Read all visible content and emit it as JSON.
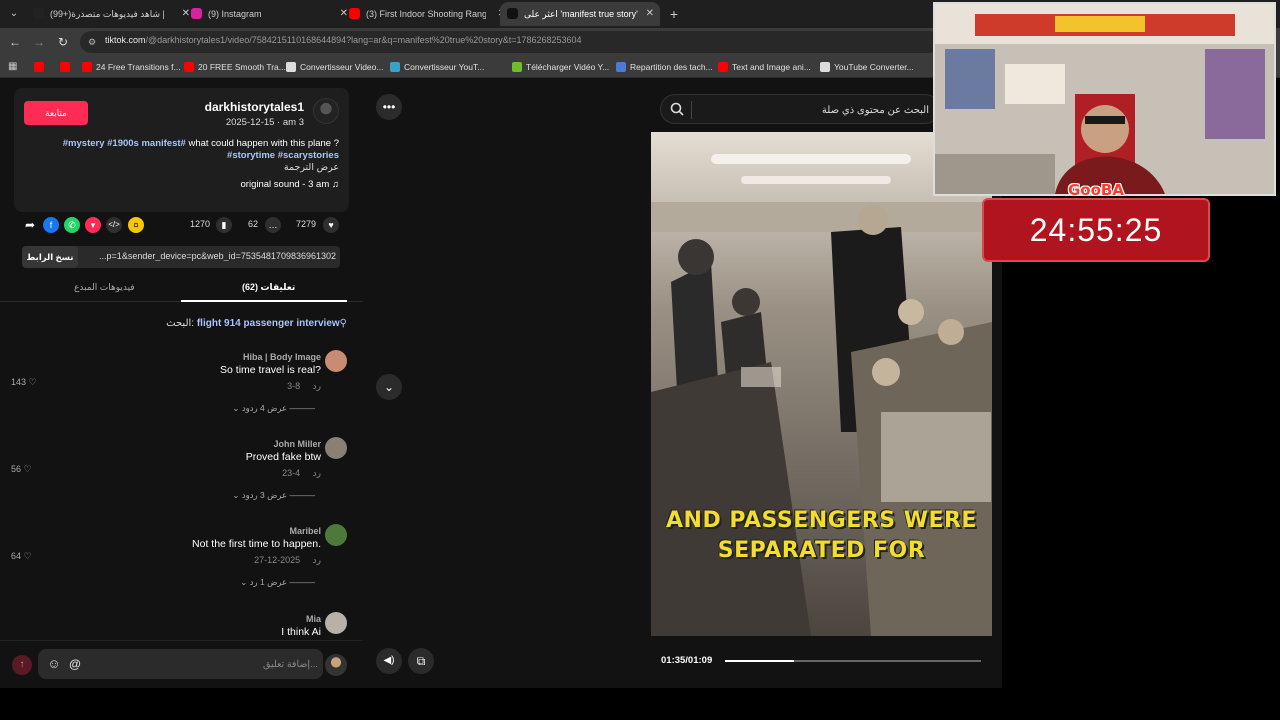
{
  "browser": {
    "tabs": [
      {
        "title": "(99+)شاهد فيديوهات متصدرة |",
        "favicon_color": "#222222",
        "active": false
      },
      {
        "title": "(9) Instagram",
        "favicon_color": "#d6249f",
        "active": false
      },
      {
        "title": "(3) First Indoor Shooting Range",
        "favicon_color": "#ff0000",
        "active": false
      },
      {
        "title": "اعثر على 'manifest true story'",
        "favicon_color": "#111111",
        "active": true
      }
    ],
    "close_glyph": "✕",
    "new_tab_glyph": "+",
    "url_host": "tiktok.com",
    "url_path": "/@darkhistorytales1/video/7584215110168644894?lang=ar&q=manifest%20true%20story&t=1786268253604",
    "bookmarks": [
      {
        "label": "",
        "color": "#ff0000"
      },
      {
        "label": "",
        "color": "#ff0000"
      },
      {
        "label": "24 Free Transitions f...",
        "color": "#ff0000"
      },
      {
        "label": "20 FREE Smooth Tra...",
        "color": "#ff0000"
      },
      {
        "label": "Convertisseur Video...",
        "color": "#dddddd"
      },
      {
        "label": "Convertisseur YouT...",
        "color": "#3aa0c8"
      },
      {
        "label": "Télécharger Vidéo Y...",
        "color": "#6cbf2a"
      },
      {
        "label": "Repartition des tach...",
        "color": "#4a7bd6"
      },
      {
        "label": "Text and Image ani...",
        "color": "#ff0000"
      },
      {
        "label": "YouTube Converter...",
        "color": "#dddddd"
      }
    ]
  },
  "post": {
    "follow_label": "متابعة",
    "username": "darkhistorytales1",
    "date": "2025-12-15 · am 3",
    "caption_text": "what could happen with this plane ?",
    "caption_tags": "#mystery #1900s manifest#",
    "caption_tags2": "#storytime #scarystories",
    "translate_label": "عرض الترجمة",
    "sound_label": "original sound - 3 am ♫",
    "likes": "7279",
    "comments": "62",
    "saves": "1270",
    "copy_label": "نسخ الرابط",
    "share_url": "...p=1&sender_device=pc&web_id=7535481709836961302",
    "tab_comments": "(62) تعليقات",
    "tab_creator_videos": "فيديوهات المبدع",
    "search_prefix": "البحث:",
    "search_query": "flight 914 passenger interview"
  },
  "comments": [
    {
      "name": "Hiba | Body Image",
      "text": "So time travel is real?",
      "date": "8-3",
      "reply_label": "رد",
      "likes": "143",
      "replies": "عرض 4 ردود",
      "avatar_color": "#c98b74"
    },
    {
      "name": "John Miller",
      "text": "Proved fake btw",
      "date": "4-23",
      "reply_label": "رد",
      "likes": "56",
      "replies": "عرض 3 ردود",
      "avatar_color": "#8a7f74"
    },
    {
      "name": "Maribel",
      "text": "Not the first time to happen.",
      "date": "2025-12-27",
      "reply_label": "رد",
      "likes": "64",
      "replies": "عرض 1 رد",
      "avatar_color": "#4d7a3a"
    },
    {
      "name": "Mia",
      "text": "I think Ai",
      "date": "",
      "reply_label": "",
      "likes": "",
      "replies": "",
      "avatar_color": "#b7b1a8"
    }
  ],
  "composer": {
    "placeholder": "إضافة تعليق..."
  },
  "video": {
    "search_placeholder": "البحث عن محتوى ذي صلة",
    "caption_line1": "AND PASSENGERS WERE",
    "caption_line2": "SEPARATED FOR",
    "time": "01:35/01:09",
    "progress_fraction": 0.27
  },
  "overlay": {
    "timer": "24:55:25",
    "streamer_label": "GooBA"
  },
  "colors": {
    "accent": "#fe2c55",
    "link": "#a8c5ff",
    "caption_yellow": "#f3dd2e",
    "timer_red": "#b0151f"
  },
  "icons": {
    "more": "•••",
    "scroll_down": "⌄",
    "volume": "🔊",
    "pip": "⧉",
    "search": "⌕",
    "heart": "♡"
  }
}
